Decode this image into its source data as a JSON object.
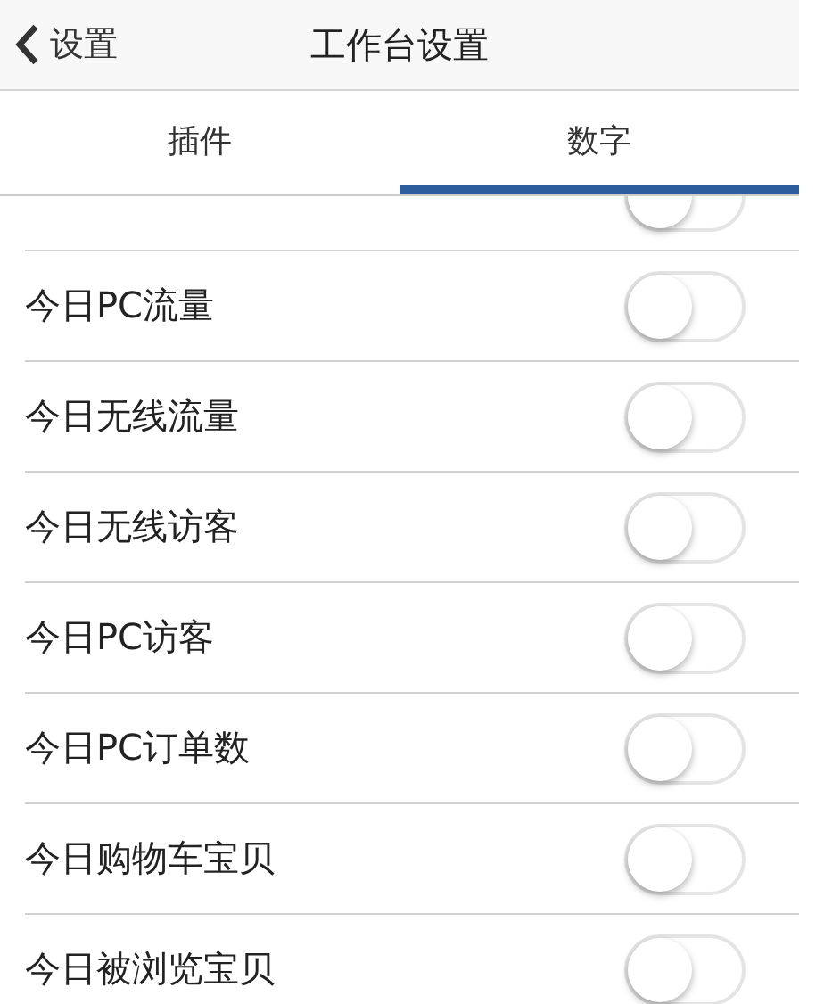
{
  "nav_bar": {
    "back_label": "设置",
    "title": "工作台设置"
  },
  "tabs": [
    {
      "label": "插件",
      "selected": false
    },
    {
      "label": "数字",
      "selected": true
    }
  ],
  "rows": [
    {
      "on": false
    },
    {
      "label": "今日PC流量",
      "on": false
    },
    {
      "label": "今日无线流量",
      "on": false
    },
    {
      "label": "今日无线访客",
      "on": false
    },
    {
      "label": "今日PC访客",
      "on": false
    },
    {
      "label": "今日PC订单数",
      "on": false
    },
    {
      "label": "今日购物车宝贝",
      "on": false
    },
    {
      "label": "今日被浏览宝贝",
      "on": false
    }
  ]
}
